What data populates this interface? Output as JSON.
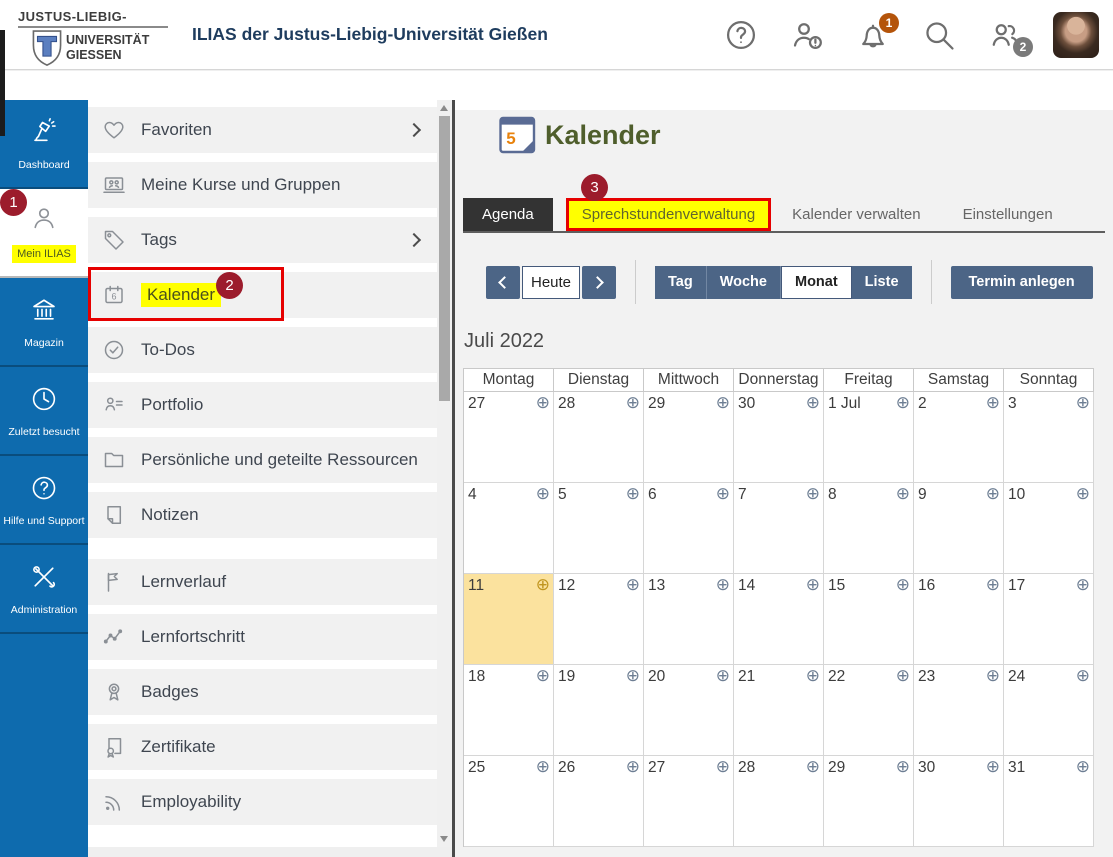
{
  "header": {
    "logo": {
      "line1": "JUSTUS-LIEBIG-",
      "line2": "UNIVERSITÄT",
      "line3": "GIESSEN"
    },
    "title": "ILIAS der Justus-Liebig-Universität Gießen",
    "icons": [
      {
        "name": "help-icon"
      },
      {
        "name": "user-status-icon"
      },
      {
        "name": "notifications-icon",
        "badge": "1",
        "badge_color": "#b4540a"
      },
      {
        "name": "search-icon"
      },
      {
        "name": "contacts-icon",
        "badge": "2",
        "badge_color": "#7a7a7a"
      },
      {
        "name": "avatar"
      }
    ]
  },
  "sidebar": {
    "items": [
      {
        "label": "Dashboard",
        "icon": "lamp-icon",
        "active": false
      },
      {
        "label": "Mein ILIAS",
        "icon": "person-icon",
        "active": true
      },
      {
        "label": "Magazin",
        "icon": "bank-icon",
        "active": false
      },
      {
        "label": "Zuletzt besucht",
        "icon": "clock-icon",
        "active": false
      },
      {
        "label": "Hilfe und Support",
        "icon": "question-icon",
        "active": false
      },
      {
        "label": "Administration",
        "icon": "tools-icon",
        "active": false
      }
    ]
  },
  "menu": {
    "items": [
      {
        "label": "Favoriten",
        "icon": "heart-icon",
        "chevron": true
      },
      {
        "label": "Meine Kurse und Gruppen",
        "icon": "courses-icon"
      },
      {
        "label": "Tags",
        "icon": "tag-icon",
        "chevron": true
      },
      {
        "label": "Kalender",
        "icon": "calendar-icon",
        "highlighted": true
      },
      {
        "label": "To-Dos",
        "icon": "todo-icon"
      },
      {
        "label": "Portfolio",
        "icon": "portfolio-icon"
      },
      {
        "label": "Persönliche und geteilte Ressourcen",
        "icon": "folder-icon"
      },
      {
        "label": "Notizen",
        "icon": "note-icon"
      },
      {
        "label": "Lernverlauf",
        "icon": "flag-icon",
        "section_start": true
      },
      {
        "label": "Lernfortschritt",
        "icon": "chart-icon"
      },
      {
        "label": "Badges",
        "icon": "medal-icon"
      },
      {
        "label": "Zertifikate",
        "icon": "certificate-icon"
      },
      {
        "label": "Employability",
        "icon": "rss-icon"
      }
    ]
  },
  "content": {
    "page_title": "Kalender",
    "page_icon_number": "5",
    "tabs": [
      {
        "label": "Agenda",
        "active": true
      },
      {
        "label": "Sprechstundenverwaltung",
        "highlighted": true
      },
      {
        "label": "Kalender verwalten"
      },
      {
        "label": "Einstellungen"
      }
    ],
    "toolbar": {
      "today_label": "Heute",
      "views": [
        {
          "label": "Tag"
        },
        {
          "label": "Woche"
        },
        {
          "label": "Monat",
          "active": true
        },
        {
          "label": "Liste"
        }
      ],
      "create_label": "Termin anlegen"
    },
    "calendar": {
      "month_label": "Juli 2022",
      "weekdays": [
        "Montag",
        "Dienstag",
        "Mittwoch",
        "Donnerstag",
        "Freitag",
        "Samstag",
        "Sonntag"
      ],
      "weeks": [
        [
          "27",
          "28",
          "29",
          "30",
          "1 Jul",
          "2",
          "3"
        ],
        [
          "4",
          "5",
          "6",
          "7",
          "8",
          "9",
          "10"
        ],
        [
          "11",
          "12",
          "13",
          "14",
          "15",
          "16",
          "17"
        ],
        [
          "18",
          "19",
          "20",
          "21",
          "22",
          "23",
          "24"
        ],
        [
          "25",
          "26",
          "27",
          "28",
          "29",
          "30",
          "31"
        ]
      ],
      "today": "11",
      "add_icon": "plus-circle-icon"
    }
  },
  "annotations": [
    {
      "number": "1",
      "target": "sidebar-mein-ilias"
    },
    {
      "number": "2",
      "target": "menu-kalender"
    },
    {
      "number": "3",
      "target": "tab-sprechstundenverwaltung"
    }
  ],
  "colors": {
    "sidebar_blue": "#0e6bae",
    "button_slate": "#4c6586",
    "highlight_yellow": "#ffff00",
    "annotation_red": "#9c1c2c",
    "box_red": "#e60000",
    "today_amber": "#fbe29e",
    "title_green": "#4f5e2c"
  }
}
